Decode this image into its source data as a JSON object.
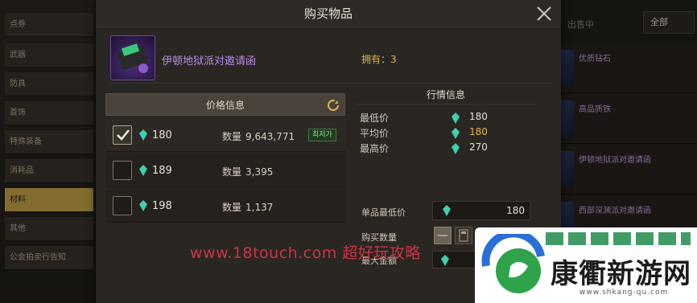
{
  "sidebar": {
    "categories": [
      "点券",
      "武器",
      "防具",
      "首饰",
      "特殊装备",
      "消耗品",
      "材料",
      "其他",
      "公会拍卖行告知"
    ],
    "active_index": 6
  },
  "listing": {
    "status_label": "出售中",
    "filter_value": "全部",
    "rows": [
      "优质钻石",
      "高品质铁",
      "伊顿地狱派对邀请函",
      "西部深渊派对邀请函"
    ]
  },
  "modal": {
    "title": "购买物品",
    "close_icon": "close-icon",
    "item": {
      "name": "伊顿地狱派对邀请函",
      "owned_label": "拥有：",
      "owned_count": "3"
    },
    "price_info": {
      "header": "价格信息",
      "refresh_icon": "refresh-icon",
      "qty_label": "数量",
      "rows": [
        {
          "price": "180",
          "qty": "9,643,771",
          "badge": "최저가",
          "checked": true
        },
        {
          "price": "189",
          "qty": "3,395",
          "badge": "",
          "checked": false
        },
        {
          "price": "198",
          "qty": "1,137",
          "badge": "",
          "checked": false
        }
      ]
    },
    "market_info": {
      "header": "行情信息",
      "rows": [
        {
          "label": "最低价",
          "value": "180"
        },
        {
          "label": "平均价",
          "value": "180"
        },
        {
          "label": "最高价",
          "value": "270"
        }
      ]
    },
    "purchase": {
      "unit_min_label": "单品最低价",
      "unit_min_value": "180",
      "qty_label": "购买数量",
      "max_label": "最大金额",
      "minus": "—"
    }
  },
  "watermark": {
    "text": "www.18touch.com 超好玩攻略",
    "brand": "康衢新游网",
    "url": "www.shkang-qu.com"
  },
  "colors": {
    "accent_gold": "#c9a64a",
    "item_purple": "#b98ce8",
    "gem_teal": "#3fd0b0",
    "badge_green": "#8de08d"
  }
}
